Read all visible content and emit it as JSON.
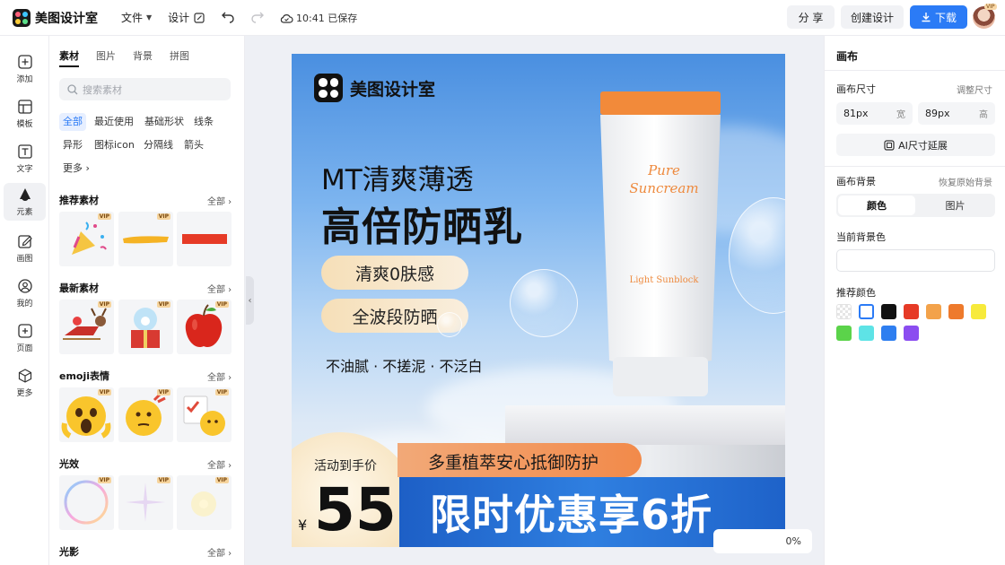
{
  "app": {
    "name": "美图设计室"
  },
  "menu": {
    "file": "文件",
    "design": "设计"
  },
  "save_status": "10:41 已保存",
  "actions": {
    "share": "分 享",
    "create": "创建设计",
    "download": "下载",
    "avatar_badge": "VIP"
  },
  "rail": [
    {
      "label": "添加",
      "icon": "plus-square-icon"
    },
    {
      "label": "模板",
      "icon": "template-icon"
    },
    {
      "label": "文字",
      "icon": "text-icon"
    },
    {
      "label": "元素",
      "icon": "shapes-icon"
    },
    {
      "label": "画图",
      "icon": "draw-icon"
    },
    {
      "label": "我的",
      "icon": "user-icon"
    },
    {
      "label": "页面",
      "icon": "page-icon"
    },
    {
      "label": "更多",
      "icon": "cube-icon"
    }
  ],
  "panel": {
    "tabs": [
      "素材",
      "图片",
      "背景",
      "拼图"
    ],
    "search_placeholder": "搜索素材",
    "chips": [
      "全部",
      "最近使用",
      "基础形状",
      "线条",
      "异形",
      "图标icon",
      "分隔线",
      "箭头",
      "更多"
    ],
    "sections": [
      {
        "title": "推荐素材",
        "all": "全部"
      },
      {
        "title": "最新素材",
        "all": "全部"
      },
      {
        "title": "emoji表情",
        "all": "全部"
      },
      {
        "title": "光效",
        "all": "全部"
      },
      {
        "title": "光影",
        "all": "全部"
      }
    ],
    "vip_badge": "VIP"
  },
  "poster": {
    "brand": "美图设计室",
    "headline1": "MT清爽薄透",
    "headline2": "高倍防晒乳",
    "pill1": "清爽0肤感",
    "pill2": "全波段防晒",
    "tagline": "不油腻 · 不搓泥 · 不泛白",
    "product_name": "Pure Suncream",
    "product_sub": "Light Sunblock",
    "banner_orange": "多重植萃安心抵御防护",
    "banner_blue": "限时优惠享6折",
    "price_label": "活动到手价",
    "currency": "¥",
    "price": "55"
  },
  "zoom": "0%",
  "right": {
    "title": "画布",
    "size_label": "画布尺寸",
    "size_link": "调整尺寸",
    "width_value": "81px",
    "width_unit": "宽",
    "height_value": "89px",
    "height_unit": "高",
    "ai_button": "AI尺寸延展",
    "bg_label": "画布背景",
    "bg_link": "恢复原始背景",
    "seg_color": "颜色",
    "seg_image": "图片",
    "current_color_label": "当前背景色",
    "recommend_label": "推荐颜色",
    "swatches": [
      "transparent",
      "#ffffff",
      "#111111",
      "#e63a26",
      "#f3a24a",
      "#ee7a2c",
      "#f7ea3b",
      "#5bd34a",
      "#5ee3e6",
      "#2e7ef0",
      "#8b4df0"
    ]
  }
}
